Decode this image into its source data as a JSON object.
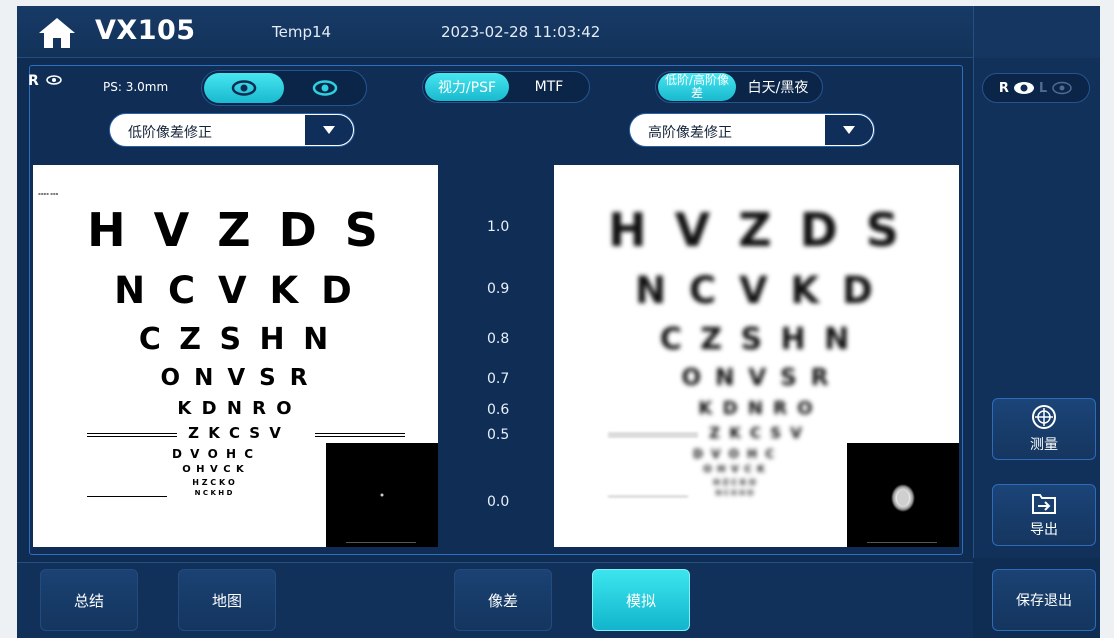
{
  "header": {
    "app_name": "VX105",
    "patient": "Temp14",
    "datetime": "2023-02-28 11:03:42"
  },
  "eye": {
    "label": "R",
    "pupil_size": "PS: 3.0mm",
    "selector_right_label": "R",
    "selector_left_label": "L"
  },
  "toggles": {
    "vision_psf": "视力/PSF",
    "mtf": "MTF",
    "low_high_aberration": "低阶/高阶像差",
    "day_night": "白天/黑夜"
  },
  "dropdowns": {
    "left": "低阶像差修正",
    "right": "高阶像差修正"
  },
  "chart": {
    "rows": [
      {
        "letters": "H V Z D S",
        "acuity": "1.0"
      },
      {
        "letters": "N C V K D",
        "acuity": "0.9"
      },
      {
        "letters": "C Z S H N",
        "acuity": "0.8"
      },
      {
        "letters": "O N V S R",
        "acuity": "0.7"
      },
      {
        "letters": "K D N R O",
        "acuity": "0.6"
      },
      {
        "letters": "Z K C S V",
        "acuity": "0.5"
      },
      {
        "letters": "D V O H C",
        "acuity": ""
      },
      {
        "letters": "O H V C K",
        "acuity": ""
      },
      {
        "letters": "H Z C K O",
        "acuity": ""
      },
      {
        "letters": "N C K H D",
        "acuity": "0.0"
      }
    ]
  },
  "side": {
    "measure": "测量",
    "export": "导出",
    "save_exit": "保存退出"
  },
  "tabs": {
    "summary": "总结",
    "map": "地图",
    "aberration": "像差",
    "simulation": "模拟"
  },
  "colors": {
    "accent": "#19b9cf",
    "background": "#0f2c53"
  }
}
